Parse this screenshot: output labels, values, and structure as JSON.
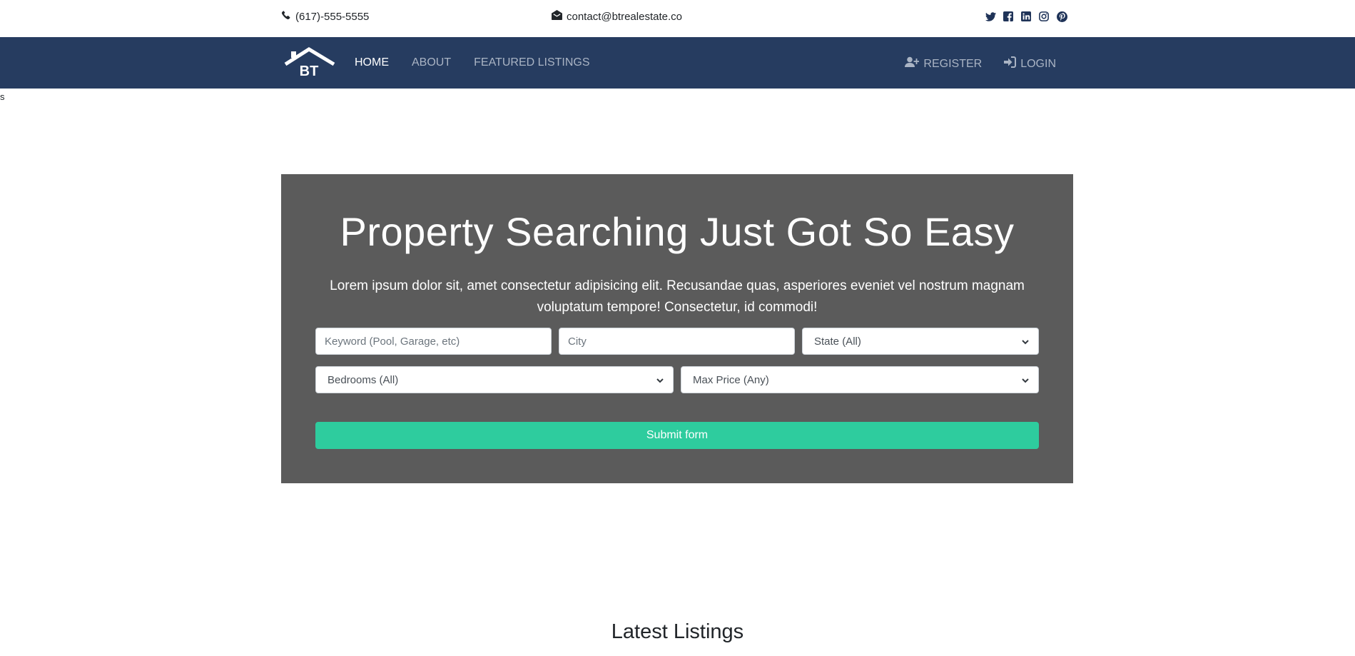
{
  "topbar": {
    "phone": "(617)-555-5555",
    "email": "contact@btrealestate.co",
    "social_icons": [
      "twitter-icon",
      "facebook-icon",
      "linkedin-icon",
      "instagram-icon",
      "pinterest-icon"
    ]
  },
  "navbar": {
    "logo_text": "BT",
    "links": [
      {
        "label": "HOME",
        "active": true
      },
      {
        "label": "ABOUT",
        "active": false
      },
      {
        "label": "FEATURED LISTINGS",
        "active": false
      }
    ],
    "register_label": "REGISTER",
    "login_label": "LOGIN"
  },
  "stray_text": "s",
  "hero": {
    "title": "Property Searching Just Got So Easy",
    "lead": "Lorem ipsum dolor sit, amet consectetur adipisicing elit. Recusandae quas, asperiores eveniet vel nostrum magnam voluptatum tempore! Consectetur, id commodi!",
    "form": {
      "keyword_placeholder": "Keyword (Pool, Garage, etc)",
      "city_placeholder": "City",
      "state_selected": "State (All)",
      "bedrooms_selected": "Bedrooms (All)",
      "price_selected": "Max Price (Any)",
      "submit_label": "Submit form"
    }
  },
  "latest_heading": "Latest Listings",
  "colors": {
    "navbar_bg": "#263c60",
    "hero_bg": "#5b5b5b",
    "submit_bg": "#2ecc9e",
    "social_icon": "#1f3358"
  }
}
